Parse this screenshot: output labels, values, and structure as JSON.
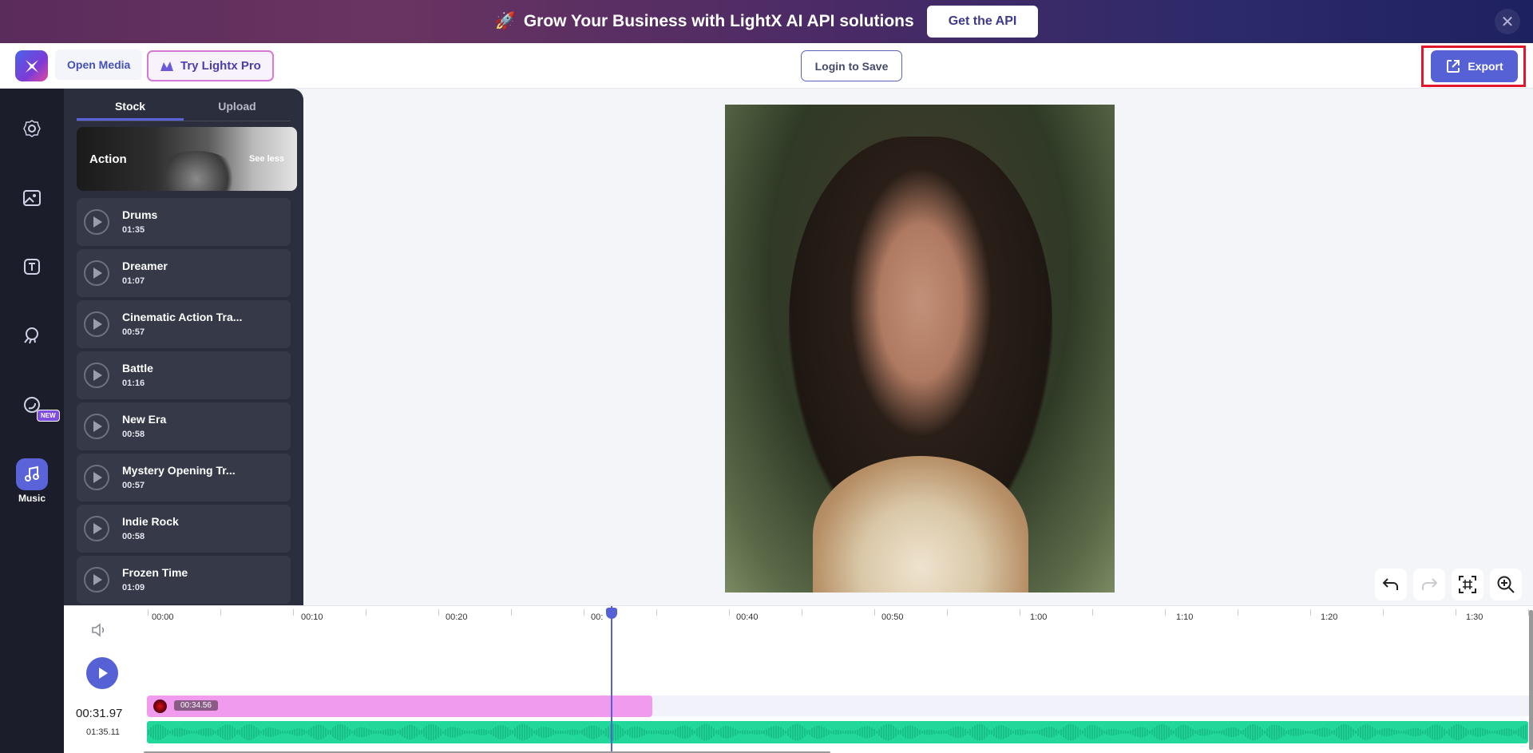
{
  "promo": {
    "emoji": "🚀",
    "text": "Grow Your Business with LightX AI API solutions",
    "button": "Get the API",
    "close": "✕"
  },
  "header": {
    "open_media": "Open Media",
    "try_pro": "Try Lightx Pro",
    "login": "Login to Save",
    "export": "Export"
  },
  "rail": {
    "items": [
      {
        "icon": "settings-icon"
      },
      {
        "icon": "image-icon"
      },
      {
        "icon": "text-icon"
      },
      {
        "icon": "effects-icon",
        "badge": "NEW"
      },
      {
        "icon": "filter-icon"
      },
      {
        "icon": "music-icon",
        "label": "Music",
        "active": true
      }
    ]
  },
  "panel": {
    "tabs": [
      "Stock",
      "Upload"
    ],
    "active_tab": "Stock",
    "category": {
      "title": "Action",
      "toggle": "See less"
    },
    "tracks": [
      {
        "name": "Drums",
        "duration": "01:35"
      },
      {
        "name": "Dreamer",
        "duration": "01:07"
      },
      {
        "name": "Cinematic Action Tra...",
        "duration": "00:57"
      },
      {
        "name": "Battle",
        "duration": "01:16"
      },
      {
        "name": "New Era",
        "duration": "00:58"
      },
      {
        "name": "Mystery Opening Tr...",
        "duration": "00:57"
      },
      {
        "name": "Indie Rock",
        "duration": "00:58"
      },
      {
        "name": "Frozen Time",
        "duration": "01:09"
      }
    ]
  },
  "timeline": {
    "ticks": [
      "00:00",
      "00:10",
      "00:20",
      "00:",
      "00:40",
      "00:50",
      "1:00",
      "1:10",
      "1:20",
      "1:30"
    ],
    "current_time": "00:31.97",
    "total_time": "01:35.11",
    "clip_label": "00:34.56"
  },
  "colors": {
    "accent": "#5661d6",
    "clip": "#f19bee",
    "audio": "#21d89a",
    "highlight": "#e0162b"
  }
}
